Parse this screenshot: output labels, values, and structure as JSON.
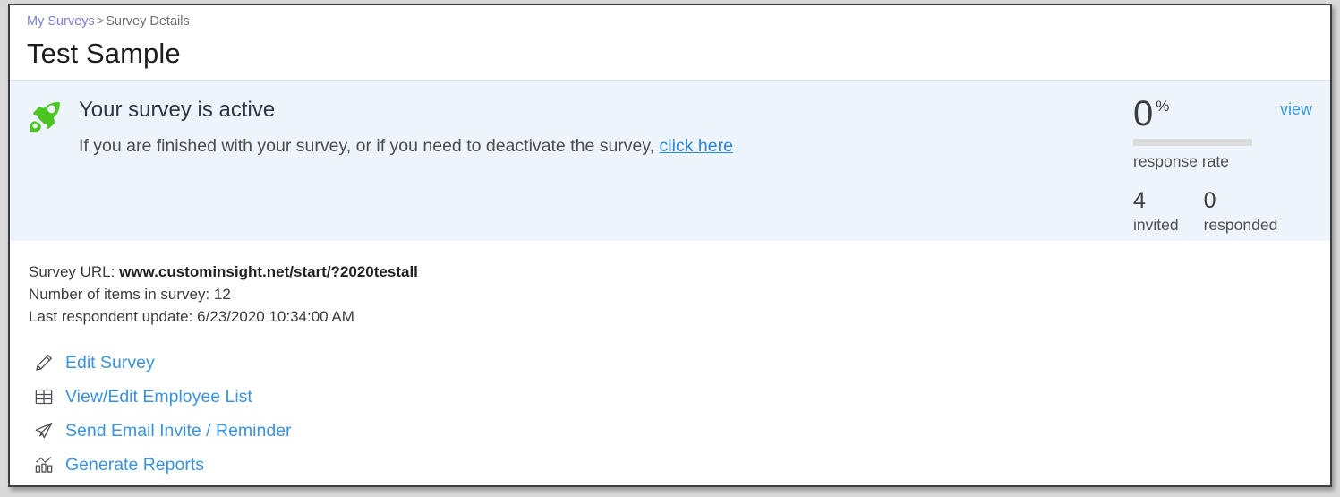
{
  "breadcrumb": {
    "root_label": "My Surveys",
    "separator": ">",
    "current_label": "Survey Details"
  },
  "page": {
    "title": "Test Sample"
  },
  "banner": {
    "icon": "rocket-icon",
    "heading": "Your survey is active",
    "sub_text_before": "If you are finished with your survey, or if you need to deactivate the survey,",
    "link_label": "click here"
  },
  "stats": {
    "response_rate_value": "0",
    "response_rate_unit": "%",
    "response_rate_percent": 0,
    "response_rate_label": "response rate",
    "view_label": "view",
    "counts": [
      {
        "value": "4",
        "label": "invited"
      },
      {
        "value": "0",
        "label": "responded"
      }
    ]
  },
  "details": [
    {
      "label": "Survey URL:",
      "value": "www.custominsight.net/start/?2020testall",
      "emphasis": "bold"
    },
    {
      "label": "Number of items in survey:",
      "value": "12",
      "emphasis": "normal"
    },
    {
      "label": "Last respondent update:",
      "value": "6/23/2020 10:34:00 AM",
      "emphasis": "normal"
    }
  ],
  "actions": [
    {
      "icon": "pencil-icon",
      "label": "Edit Survey"
    },
    {
      "icon": "table-icon",
      "label": "View/Edit Employee List"
    },
    {
      "icon": "paper-plane-icon",
      "label": "Send Email Invite / Reminder"
    },
    {
      "icon": "bar-chart-icon",
      "label": "Generate Reports"
    }
  ],
  "colors": {
    "banner_background": "#edf4fc",
    "link_blue": "#3b93dd",
    "rocket_green": "#4bc521",
    "breadcrumb_link": "#7a7fd4",
    "progress_track": "#dcdcdc"
  }
}
